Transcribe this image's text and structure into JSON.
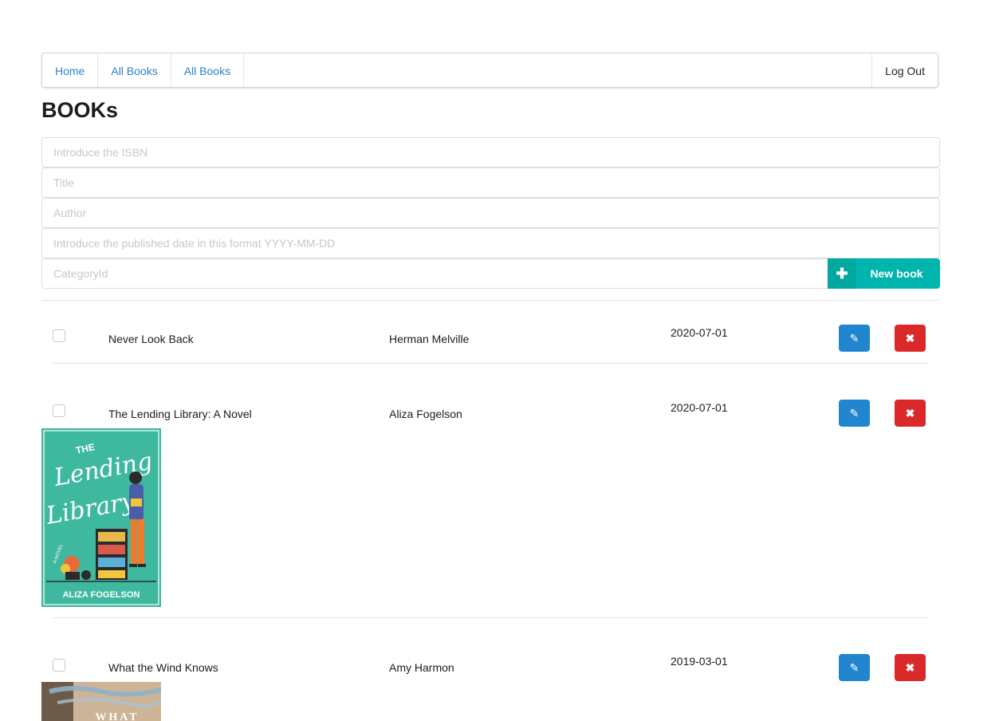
{
  "nav": {
    "items": [
      "Home",
      "All Books",
      "All Books"
    ],
    "logout_label": "Log Out"
  },
  "page_title": "BOOKs",
  "form": {
    "isbn_placeholder": "Introduce the ISBN",
    "title_placeholder": "Title",
    "author_placeholder": "Author",
    "date_placeholder": "Introduce the published date in this format YYYY-MM-DD",
    "category_placeholder": "CategoryId",
    "new_book_label": "New book",
    "new_book_icon": "plus-icon"
  },
  "books": [
    {
      "title": "Never Look Back",
      "author": "Herman Melville",
      "date": "2020-07-01",
      "has_cover": false
    },
    {
      "title": "The Lending Library: A Novel",
      "author": "Aliza Fogelson",
      "date": "2020-07-01",
      "has_cover": true,
      "cover": {
        "line1": "THE",
        "line2": "Lending",
        "line3": "Library",
        "side": "A NOVEL",
        "author": "ALIZA FOGELSON",
        "bg": "#3fb8a0"
      }
    },
    {
      "title": "What the Wind Knows",
      "author": "Amy Harmon",
      "date": "2019-03-01",
      "has_cover": true,
      "cover": {
        "line1": "WHAT"
      }
    }
  ],
  "icons": {
    "edit": "pencil-icon",
    "delete": "close-icon"
  },
  "colors": {
    "link": "#2b80c8",
    "teal": "#00b5ad",
    "blue": "#2185d0",
    "red": "#db2828"
  }
}
